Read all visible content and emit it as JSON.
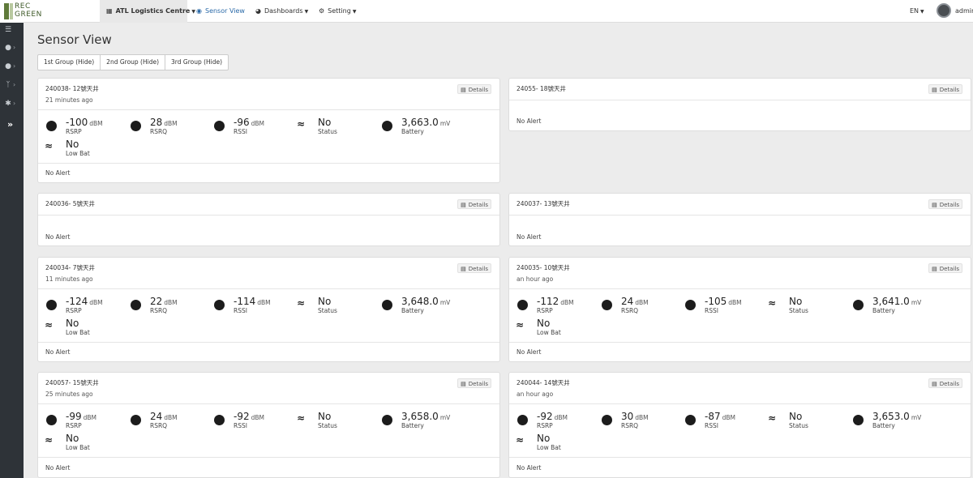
{
  "brand": {
    "line1": "REC",
    "line2": "GREEN"
  },
  "nav": {
    "site": {
      "label": "ATL Logistics Centre",
      "icon": "grid-icon"
    },
    "sensor_view": {
      "label": "Sensor View",
      "icon": "globe-icon"
    },
    "dashboards": {
      "label": "Dashboards",
      "icon": "dashboard-icon"
    },
    "setting": {
      "label": "Setting",
      "icon": "gear-icon"
    },
    "language": "EN",
    "user": "admin"
  },
  "sidebar": {
    "items": [
      {
        "icon": "list-icon"
      },
      {
        "icon": "users-icon"
      },
      {
        "icon": "user-group-icon"
      },
      {
        "icon": "branch-icon"
      },
      {
        "icon": "bug-icon"
      },
      {
        "icon": "expand-icon"
      }
    ]
  },
  "page": {
    "title": "Sensor View",
    "groups": [
      "1st Group (Hide)",
      "2nd Group (Hide)",
      "3rd Group (Hide)"
    ]
  },
  "details_label": "Details",
  "labels": {
    "rsrp": "RSRP",
    "rsrq": "RSRQ",
    "rssi": "RSSI",
    "status": "Status",
    "battery": "Battery",
    "lowbat": "Low Bat",
    "unit_dbm": "dBM",
    "unit_mv": "mV"
  },
  "cards": [
    {
      "name": "240038- 12號天井",
      "time": "21 minutes ago",
      "rsrp": "-100",
      "rsrq": "28",
      "rssi": "-96",
      "status": "No",
      "battery": "3,663.0",
      "lowbat": "No",
      "alert": "No Alert"
    },
    {
      "name": "24055- 18號天井",
      "alert": "No Alert"
    },
    {
      "name": "240036- 5號天井",
      "alert": "No Alert"
    },
    {
      "name": "240037- 13號天井",
      "alert": "No Alert"
    },
    {
      "name": "240034- 7號天井",
      "time": "11 minutes ago",
      "rsrp": "-124",
      "rsrq": "22",
      "rssi": "-114",
      "status": "No",
      "battery": "3,648.0",
      "lowbat": "No",
      "alert": "No Alert"
    },
    {
      "name": "240035- 10號天井",
      "time": "an hour ago",
      "rsrp": "-112",
      "rsrq": "24",
      "rssi": "-105",
      "status": "No",
      "battery": "3,641.0",
      "lowbat": "No",
      "alert": "No Alert"
    },
    {
      "name": "240057- 15號天井",
      "time": "25 minutes ago",
      "rsrp": "-99",
      "rsrq": "24",
      "rssi": "-92",
      "status": "No",
      "battery": "3,658.0",
      "lowbat": "No",
      "alert": "No Alert"
    },
    {
      "name": "240044- 14號天井",
      "time": "an hour ago",
      "rsrp": "-92",
      "rsrq": "30",
      "rssi": "-87",
      "status": "No",
      "battery": "3,653.0",
      "lowbat": "No",
      "alert": "No Alert"
    }
  ]
}
